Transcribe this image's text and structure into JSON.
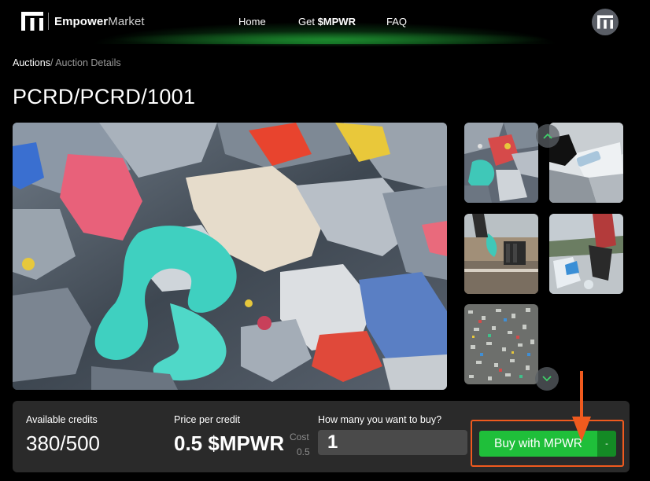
{
  "header": {
    "brand_bold": "Empower",
    "brand_light": "Market",
    "nav": {
      "home": "Home",
      "get_prefix": "Get ",
      "get_token": "$MPWR",
      "faq": "FAQ"
    }
  },
  "breadcrumb": {
    "parent": "Auctions",
    "separator": "/",
    "current": " Auction Details"
  },
  "page_title": "PCRD/PCRD/1001",
  "gallery": {
    "main_image": "plastic-waste-closeup-image",
    "thumbnails": [
      "plastic-pile-thumbnail",
      "hand-holding-bottle-thumbnail",
      "person-collecting-plastic-thumbnail",
      "beach-cleanup-thumbnail",
      "plastic-flakes-thumbnail"
    ]
  },
  "buy_panel": {
    "available_label": "Available credits",
    "available_value": "380/500",
    "price_label": "Price per credit",
    "price_value": "0.5 $MPWR",
    "cost_label": "Cost",
    "cost_value": "0.5",
    "qty_label": "How many you want to buy?",
    "qty_value": "1",
    "buy_button": "Buy with MPWR",
    "dropdown_glyph": "-"
  },
  "colors": {
    "buy_green": "#1fbf3a",
    "buy_dropdown": "#148a25",
    "highlight_orange": "#f05a1e",
    "panel_bg": "#2a2a2a"
  }
}
